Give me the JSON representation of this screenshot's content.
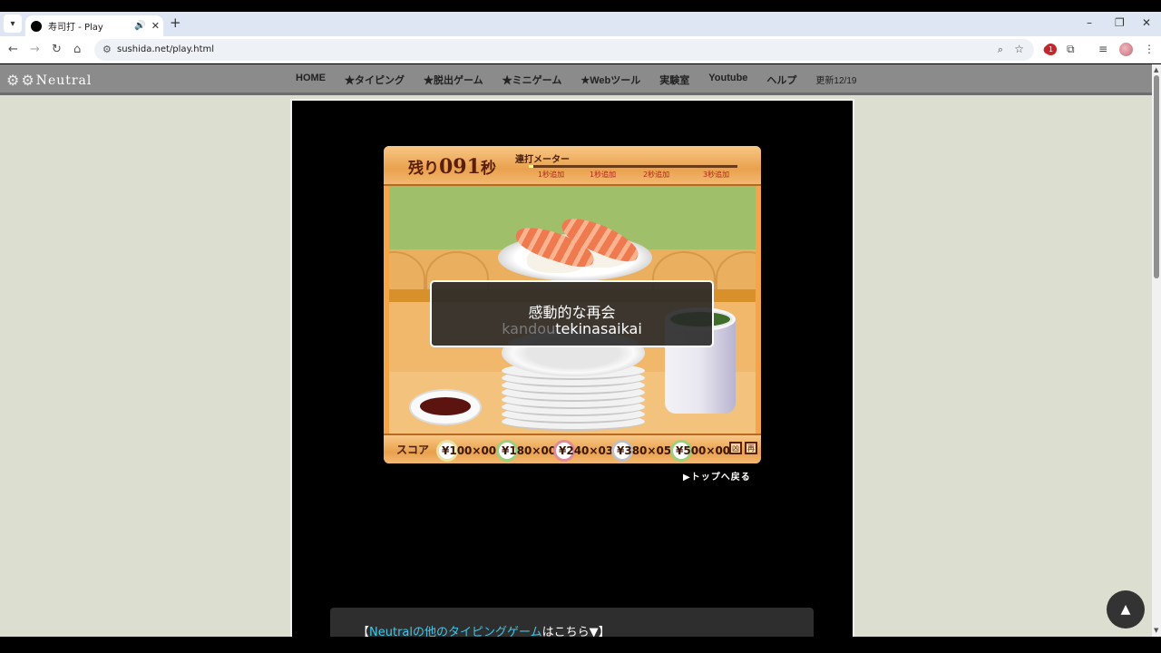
{
  "browser": {
    "tab_title": "寿司打 - Play",
    "url": "sushida.net/play.html",
    "audio_icon": "speaker-icon",
    "close_glyph": "✕",
    "new_tab_glyph": "+",
    "minimize_glyph": "–",
    "restore_glyph": "❐",
    "window_close_glyph": "✕",
    "back_glyph": "←",
    "forward_glyph": "→",
    "reload_glyph": "↻",
    "home_glyph": "⌂",
    "ext_badge_count": "1"
  },
  "site": {
    "logo_text": "Neutral",
    "nav": [
      "HOME",
      "★タイピング",
      "★脱出ゲーム",
      "★ミニゲーム",
      "★Webツール",
      "実験室",
      "Youtube",
      "ヘルプ",
      "更新12/19"
    ]
  },
  "game": {
    "timer_prefix": "残り",
    "timer_value": "091",
    "timer_suffix": "秒",
    "meter_label": "連打メーター",
    "meter_fill_fraction": 0.02,
    "meter_marks": [
      "1秒追加",
      "1秒追加",
      "2秒追加",
      "3秒追加"
    ],
    "phrase_jp": "感動的な再会",
    "romaji_typed": "kandou",
    "romaji_remaining": "tekinasaikai",
    "score_label": "スコア",
    "plates": [
      {
        "price": "¥100",
        "count": "×00",
        "color": "#e8e4a0"
      },
      {
        "price": "¥180",
        "count": "×00",
        "color": "#9ccf7a"
      },
      {
        "price": "¥240",
        "count": "×03",
        "color": "#e08a9a"
      },
      {
        "price": "¥380",
        "count": "×05",
        "color": "#c0c0c0"
      },
      {
        "price": "¥500",
        "count": "×00",
        "color": "#9ccf7a"
      }
    ],
    "corner_icons": [
      "凶",
      "再"
    ],
    "back_link": "▶トップへ戻る"
  },
  "footer_box": {
    "open_bracket": "【",
    "link_text": "Neutralの他のタイピングゲーム",
    "rest_text": "はこちら▼】"
  },
  "scroll_top_glyph": "▲"
}
